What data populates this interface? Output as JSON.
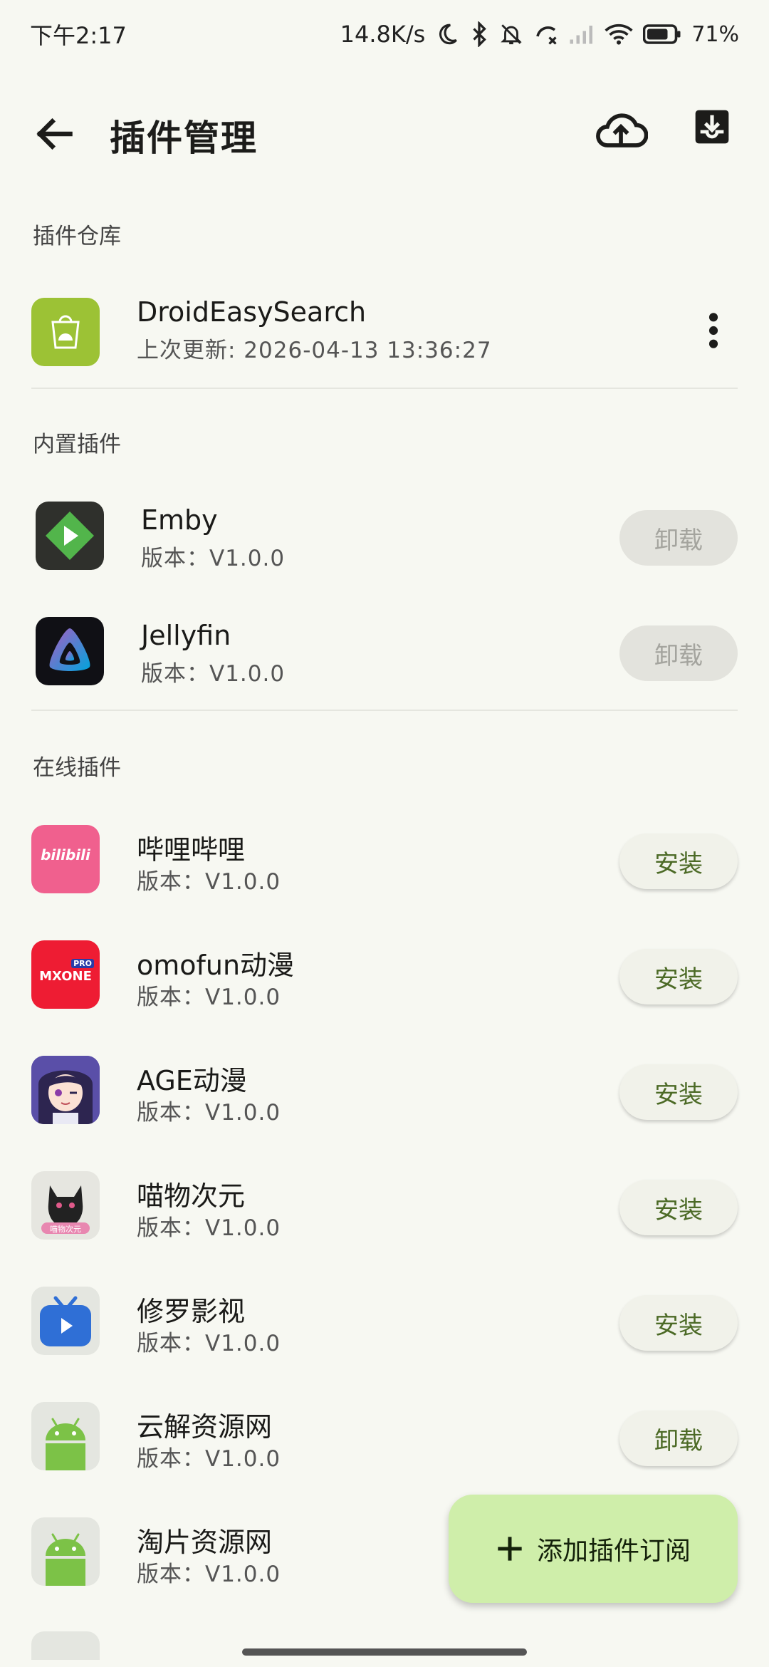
{
  "status_bar": {
    "time": "下午2:17",
    "net_speed": "14.8K/s",
    "battery": "71%"
  },
  "header": {
    "title": "插件管理",
    "back_icon": "arrow-left-icon",
    "upload_icon": "cloud-upload-icon",
    "import_icon": "inbox-download-icon"
  },
  "repository": {
    "section_label": "插件仓库",
    "name": "DroidEasySearch",
    "updated": "上次更新: 2026-04-13 13:36:27"
  },
  "builtin": {
    "section_label": "内置插件",
    "items": [
      {
        "name": "Emby",
        "version": "版本：V1.0.0",
        "action": "卸载"
      },
      {
        "name": "Jellyfin",
        "version": "版本：V1.0.0",
        "action": "卸载"
      }
    ]
  },
  "online": {
    "section_label": "在线插件",
    "items": [
      {
        "name": "哔哩哔哩",
        "version": "版本：V1.0.0",
        "action": "安装",
        "icon_text": "bilibili"
      },
      {
        "name": "omofun动漫",
        "version": "版本：V1.0.0",
        "action": "安装",
        "icon_text": "MXONE",
        "icon_badge": "PRO"
      },
      {
        "name": "AGE动漫",
        "version": "版本：V1.0.0",
        "action": "安装"
      },
      {
        "name": "喵物次元",
        "version": "版本：V1.0.0",
        "action": "安装",
        "icon_text": "喵物次元"
      },
      {
        "name": "修罗影视",
        "version": "版本：V1.0.0",
        "action": "安装"
      },
      {
        "name": "云解资源网",
        "version": "版本：V1.0.0",
        "action": "卸载"
      },
      {
        "name": "淘片资源网",
        "version": "版本：V1.0.0",
        "action": ""
      }
    ]
  },
  "fab": {
    "label": "添加插件订阅"
  },
  "colors": {
    "background": "#f7f8f2",
    "accent_text": "#4c6a26",
    "fab": "#cfeeaa",
    "bilibili": "#f0608e",
    "mxone": "#ee1c33",
    "emby": "#52b54b",
    "xiuluo": "#2f6fd6",
    "android": "#7cc247"
  }
}
